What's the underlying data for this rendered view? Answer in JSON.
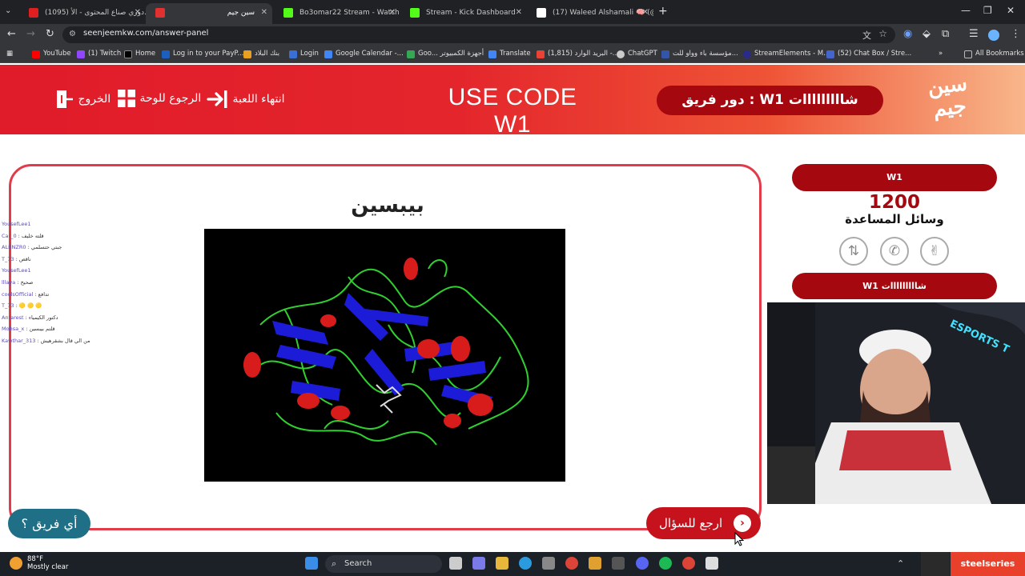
{
  "browser": {
    "tabs": [
      {
        "label": "(1095) دوري صناع المحتوى - الأ...",
        "color": "#e02020",
        "active": false
      },
      {
        "label": "سين جيم",
        "color": "#e03030",
        "active": true
      },
      {
        "label": "Bo3omar22 Stream - Watch",
        "color": "#53fc18",
        "active": false
      },
      {
        "label": "Stream - Kick Dashboard",
        "color": "#53fc18",
        "active": false
      },
      {
        "label": "(17) Waleed Alshamali 🧠 (@W",
        "color": "#ffffff",
        "active": false
      }
    ],
    "url": "seenjeemkw.com/answer-panel",
    "bookmarks": [
      {
        "label": "YouTube",
        "color": "#ff0000"
      },
      {
        "label": "(1) Twitch",
        "color": "#9146ff"
      },
      {
        "label": "Home",
        "color": "#000000"
      },
      {
        "label": "Log in to your PayP...",
        "color": "#1b5fc1"
      },
      {
        "label": "بنك البلاد",
        "color": "#e8a020"
      },
      {
        "label": "Login",
        "color": "#3a6fd8"
      },
      {
        "label": "Google Calendar -...",
        "color": "#4285f4"
      },
      {
        "label": "Goo... أجهزة الكمبيوتر",
        "color": "#34a853"
      },
      {
        "label": "Translate",
        "color": "#4285f4"
      },
      {
        "label": "(1,815) البريد الوارد -...",
        "color": "#ea4335"
      },
      {
        "label": "ChatGPT",
        "color": "#cccccc"
      },
      {
        "label": "مؤسسة باء وواو للت...",
        "color": "#3355aa"
      },
      {
        "label": "StreamElements - M...",
        "color": "#2a2a8a"
      },
      {
        "label": "(52) Chat Box / Stre...",
        "color": "#4466cc"
      }
    ],
    "all_bookmarks": "All Bookmarks"
  },
  "header": {
    "logo_line1": "سين",
    "logo_line2": "جيم",
    "turn_label": "دور فريق : W1 شااااااااات",
    "use_code": "USE CODE W1",
    "end_game": "انتهاء اللعبة",
    "back_to_board": "الرجوع للوحة",
    "exit": "الخروج"
  },
  "question": {
    "title": "بيبسين"
  },
  "chat": [
    {
      "user": "YousefLee1",
      "msg": ""
    },
    {
      "user": "Car_0",
      "msg": "قلته خليف"
    },
    {
      "user": "ALBNZR0",
      "msg": "جبتي حتسلمي"
    },
    {
      "user": "T_73",
      "msg": "ناقص"
    },
    {
      "user": "YousefLee1",
      "msg": ""
    },
    {
      "user": "lllaya",
      "msg": "صحيح"
    },
    {
      "user": "coolsOfficial",
      "msg": "تدافع"
    },
    {
      "user": "T_73",
      "msg": "🟡 🟡 🟡"
    },
    {
      "user": "Antarest",
      "msg": "دكتور الكيمياء"
    },
    {
      "user": "Mohsa_x",
      "msg": "قلتم بيبسين"
    },
    {
      "user": "Kawthar_313",
      "msg": "من الي قال بشقرهيش"
    }
  ],
  "buttons": {
    "which_team": "أي فريق ؟",
    "back_to_question": "ارجع للسؤال"
  },
  "sidebar": {
    "team_name": "W1",
    "score": "1200",
    "helps_label": "وسائل المساعدة",
    "team_bottom": "W1 شااااااااات",
    "lifelines": [
      "hand-icon",
      "phone-icon",
      "swap-icon"
    ]
  },
  "webcam": {
    "overlay_text": "ESPORTS T"
  },
  "taskbar": {
    "temperature": "88°F",
    "condition": "Mostly clear",
    "search": "Search",
    "brand": "steelseries"
  }
}
